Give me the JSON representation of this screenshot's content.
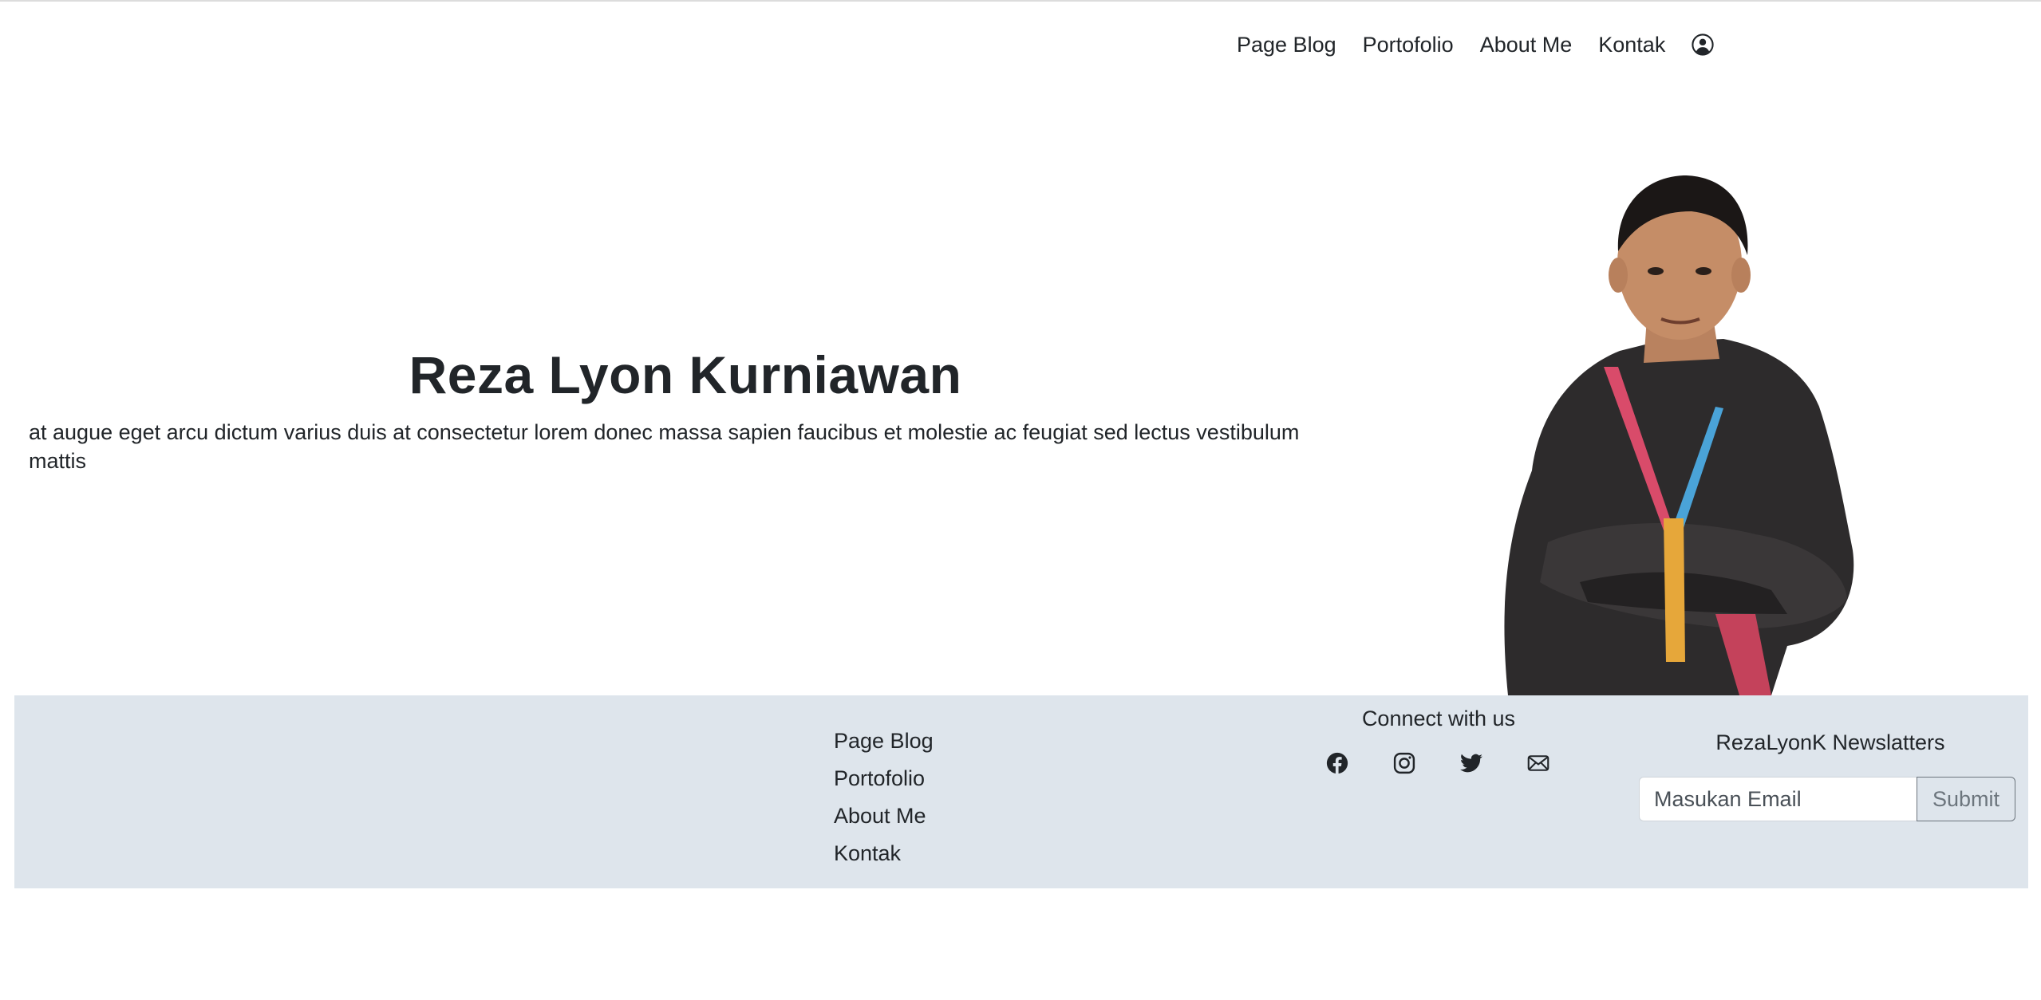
{
  "nav": {
    "links": [
      "Page Blog",
      "Portofolio",
      "About Me",
      "Kontak"
    ],
    "user_icon": "user-circle-icon"
  },
  "hero": {
    "name": "Reza Lyon Kurniawan",
    "description": "at augue eget arcu dictum varius duis at consectetur lorem donec massa sapien faucibus et molestie ac feugiat sed lectus vestibulum mattis"
  },
  "footer": {
    "links": [
      "Page Blog",
      "Portofolio",
      "About Me",
      "Kontak"
    ],
    "connect_title": "Connect with us",
    "social_icons": [
      "facebook-icon",
      "instagram-icon",
      "twitter-icon",
      "email-icon"
    ],
    "newsletter_title": "RezaLyonK Newslatters",
    "email_placeholder": "Masukan Email",
    "submit_label": "Submit"
  },
  "colors": {
    "footer_bg": "#dee5ec",
    "text": "#212529",
    "submit_border": "#6c757d"
  }
}
